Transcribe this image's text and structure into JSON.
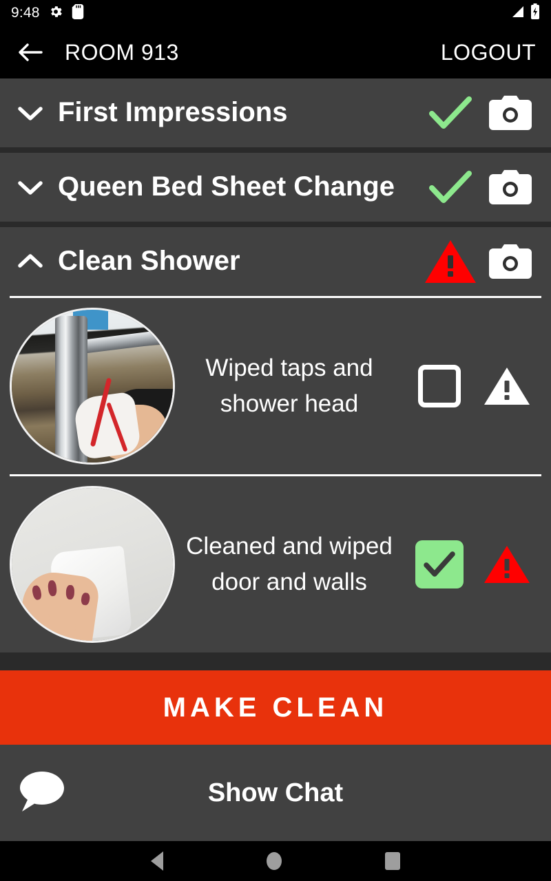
{
  "status_bar": {
    "time": "9:48",
    "icons": [
      "gear-icon",
      "sd-card-icon",
      "signal-icon",
      "battery-charging-icon"
    ]
  },
  "app_bar": {
    "back_icon": "back-arrow-icon",
    "title": "ROOM 913",
    "logout_label": "LOGOUT"
  },
  "colors": {
    "accent_red": "#E8320C",
    "warning_red": "#FF0000",
    "check_green": "#8DE88D",
    "section_bg": "#414141",
    "page_bg": "#2A2A2A",
    "bar_black": "#000000"
  },
  "sections": [
    {
      "title": "First Impressions",
      "expanded": false,
      "chevron": "chevron-down-icon",
      "status": "check",
      "camera": "camera-icon",
      "tasks": []
    },
    {
      "title": "Queen Bed Sheet Change",
      "expanded": false,
      "chevron": "chevron-down-icon",
      "status": "check",
      "camera": "camera-icon",
      "tasks": []
    },
    {
      "title": "Clean Shower",
      "expanded": true,
      "chevron": "chevron-up-icon",
      "status": "warning",
      "camera": "camera-icon",
      "tasks": [
        {
          "label": "Wiped taps and shower head",
          "photo": "tap-being-wiped-photo",
          "checked": false,
          "warning": "white"
        },
        {
          "label": "Cleaned and wiped door and walls",
          "photo": "wall-being-wiped-photo",
          "checked": true,
          "warning": "red"
        }
      ]
    }
  ],
  "make_clean_button": {
    "label": "MAKE CLEAN"
  },
  "chat_bar": {
    "icon": "speech-bubble-icon",
    "label": "Show Chat"
  },
  "nav_bar": {
    "back": "nav-back-icon",
    "home": "nav-home-icon",
    "recents": "nav-recents-icon"
  }
}
